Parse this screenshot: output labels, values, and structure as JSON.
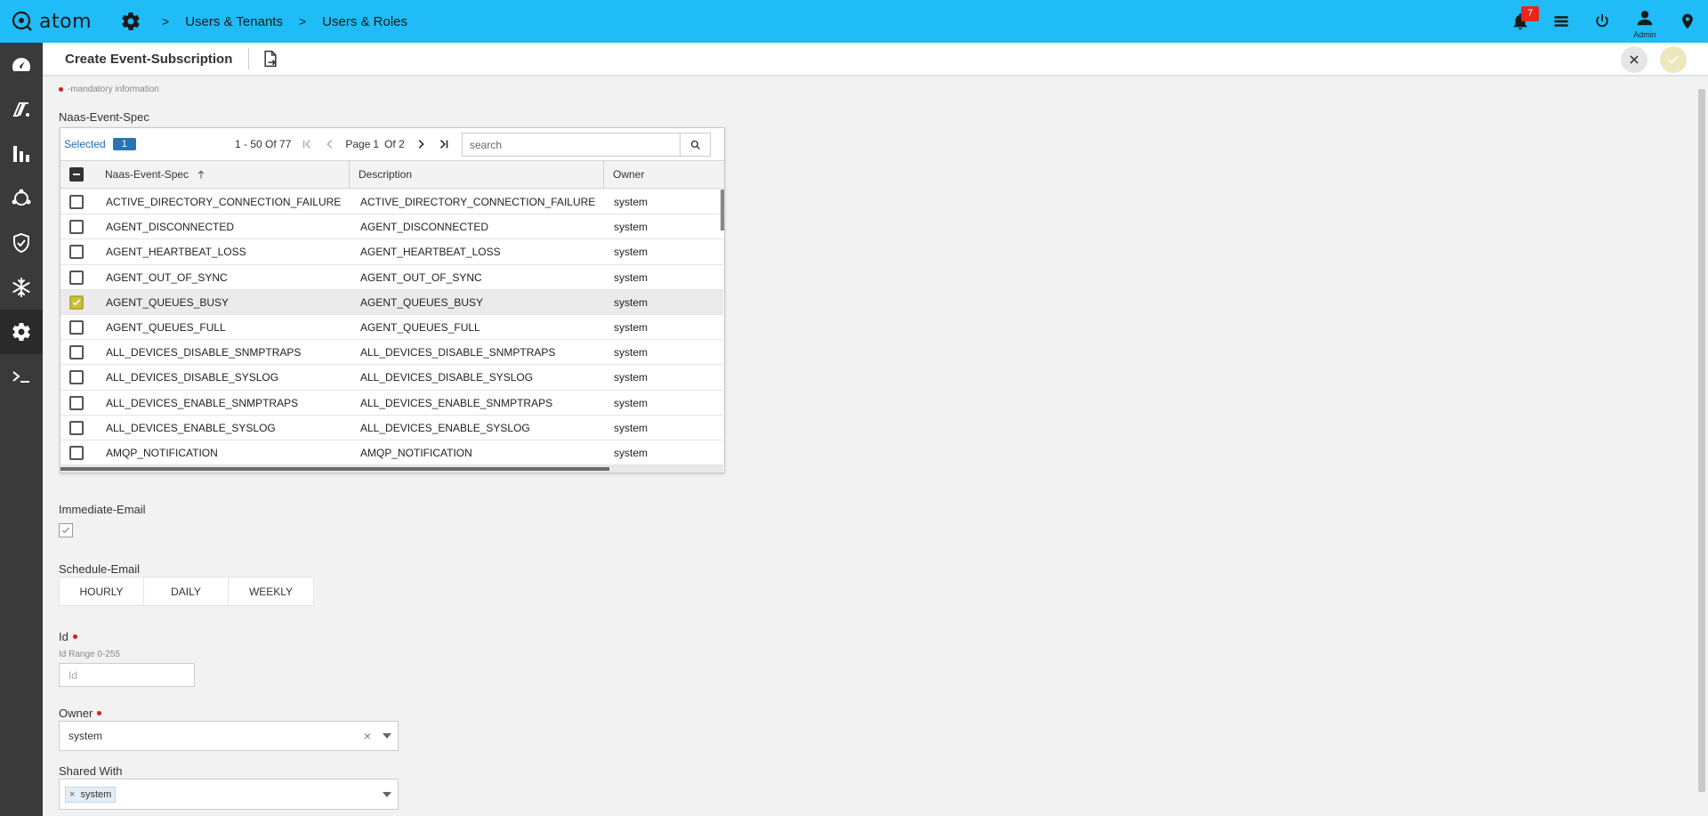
{
  "app": {
    "logo_text": "atom"
  },
  "breadcrumb": {
    "items": [
      "Users & Tenants",
      "Users & Roles"
    ]
  },
  "notifications": {
    "count": "7"
  },
  "user": {
    "label": "Admin"
  },
  "header": {
    "title": "Create Event-Subscription"
  },
  "form": {
    "mandatory_note": "-mandatory information",
    "spec_label": "Naas-Event-Spec",
    "immediate_email_label": "Immediate-Email",
    "schedule_email_label": "Schedule-Email",
    "schedule_options": [
      "HOURLY",
      "DAILY",
      "WEEKLY"
    ],
    "id_label": "Id",
    "id_hint": "Id Range 0-255",
    "id_placeholder": "Id",
    "owner_label": "Owner",
    "owner_value": "system",
    "shared_label": "Shared With",
    "shared_chip": "system"
  },
  "grid": {
    "selected_label": "Selected",
    "selected_count": "1",
    "range_text": "1 - 50 Of 77",
    "page_label": "Page",
    "page_current": "1",
    "page_of": "Of 2",
    "search_placeholder": "search",
    "columns": [
      "Naas-Event-Spec",
      "Description",
      "Owner"
    ],
    "rows": [
      {
        "spec": "ACTIVE_DIRECTORY_CONNECTION_FAILURE",
        "desc": "ACTIVE_DIRECTORY_CONNECTION_FAILURE",
        "owner": "system",
        "checked": false
      },
      {
        "spec": "AGENT_DISCONNECTED",
        "desc": "AGENT_DISCONNECTED",
        "owner": "system",
        "checked": false
      },
      {
        "spec": "AGENT_HEARTBEAT_LOSS",
        "desc": "AGENT_HEARTBEAT_LOSS",
        "owner": "system",
        "checked": false
      },
      {
        "spec": "AGENT_OUT_OF_SYNC",
        "desc": "AGENT_OUT_OF_SYNC",
        "owner": "system",
        "checked": false
      },
      {
        "spec": "AGENT_QUEUES_BUSY",
        "desc": "AGENT_QUEUES_BUSY",
        "owner": "system",
        "checked": true
      },
      {
        "spec": "AGENT_QUEUES_FULL",
        "desc": "AGENT_QUEUES_FULL",
        "owner": "system",
        "checked": false
      },
      {
        "spec": "ALL_DEVICES_DISABLE_SNMPTRAPS",
        "desc": "ALL_DEVICES_DISABLE_SNMPTRAPS",
        "owner": "system",
        "checked": false
      },
      {
        "spec": "ALL_DEVICES_DISABLE_SYSLOG",
        "desc": "ALL_DEVICES_DISABLE_SYSLOG",
        "owner": "system",
        "checked": false
      },
      {
        "spec": "ALL_DEVICES_ENABLE_SNMPTRAPS",
        "desc": "ALL_DEVICES_ENABLE_SNMPTRAPS",
        "owner": "system",
        "checked": false
      },
      {
        "spec": "ALL_DEVICES_ENABLE_SYSLOG",
        "desc": "ALL_DEVICES_ENABLE_SYSLOG",
        "owner": "system",
        "checked": false
      },
      {
        "spec": "AMQP_NOTIFICATION",
        "desc": "AMQP_NOTIFICATION",
        "owner": "system",
        "checked": false
      }
    ]
  },
  "sidebar": {
    "icons": [
      "dashboard-icon",
      "devices-icon",
      "analytics-icon",
      "topology-icon",
      "security-icon",
      "snowflake-icon",
      "settings-icon",
      "terminal-icon"
    ]
  },
  "colors": {
    "topbar": "#1fbcf8",
    "sidebar": "#3a3a3a",
    "accent": "#2874b5",
    "mandatory": "#d02020",
    "check": "#c8c040"
  }
}
